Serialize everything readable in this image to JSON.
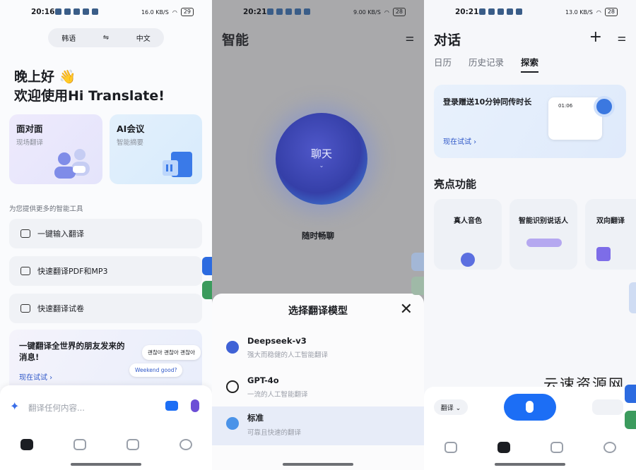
{
  "panel1": {
    "status_time": "20:16",
    "status_speed": "16.0 KB/S",
    "battery": "29",
    "lang_from": "韩语",
    "lang_swap": "⇋",
    "lang_to": "中文",
    "greeting_line1": "晚上好 👋",
    "greeting_line2": "欢迎使用Hi Translate!",
    "card_face_title": "面对面",
    "card_face_sub": "现场翻译",
    "card_ai_title": "AI会议",
    "card_ai_sub": "智能摘要",
    "tools_label": "为您提供更多的智能工具",
    "tools": [
      "一键输入翻译",
      "快速翻译PDF和MP3",
      "快速翻译试卷"
    ],
    "promo_title": "一键翻译全世界的朋友发来的消息!",
    "promo_try": "现在试试 ›",
    "bubble_ko": "괜찮아 괜찮아 괜찮아",
    "bubble_en": "Weekend good?",
    "input_placeholder": "翻译任何内容..."
  },
  "panel2": {
    "status_time": "20:21",
    "status_speed": "9.00 KB/S",
    "battery": "28",
    "title": "智能",
    "orb_label": "聊天",
    "orb_sub": "随时畅聊",
    "sheet_title": "选择翻译模型",
    "models": [
      {
        "name": "Deepseek-v3",
        "desc": "强大而稳健的人工智能翻译"
      },
      {
        "name": "GPT-4o",
        "desc": "一流的人工智能翻译"
      },
      {
        "name": "标准",
        "desc": "可靠且快速的翻译"
      }
    ]
  },
  "panel3": {
    "status_time": "20:21",
    "status_speed": "13.0 KB/S",
    "battery": "28",
    "title": "对话",
    "tabs": [
      "日历",
      "历史记录",
      "探索"
    ],
    "banner_title": "登录赠送10分钟同传时长",
    "banner_try": "现在试试 ›",
    "banner_timer": "01:06",
    "section_title": "亮点功能",
    "features": [
      "真人音色",
      "智能识别说话人",
      "双向翻译"
    ],
    "bar_pill": "翻译 ⌄",
    "watermark": "云速资源网"
  },
  "colors": {
    "accent": "#1c6ef5",
    "link": "#2e57c8"
  }
}
